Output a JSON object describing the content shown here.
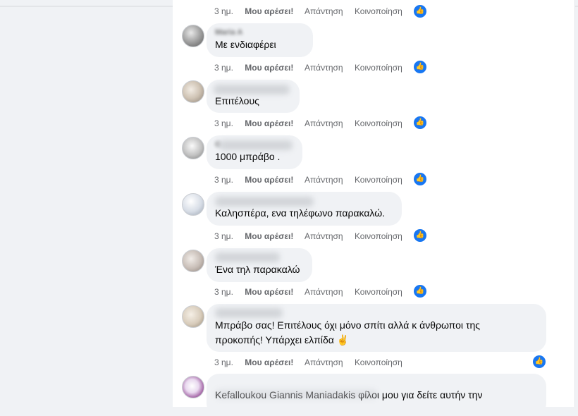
{
  "actions": {
    "time": "3 ημ.",
    "like": "Μου αρέσει!",
    "reply": "Απάντηση",
    "share": "Κοινοποίηση"
  },
  "reaction_icon": "thumbs-up-icon",
  "accent_color": "#1877f2",
  "comments": [
    {
      "name": "Maria A",
      "text": "Με ενδιαφέρει"
    },
    {
      "name": "",
      "text": "Επιτέλους"
    },
    {
      "name": "G",
      "text": "1000 μπράβο ."
    },
    {
      "name": "",
      "text": "Καλησπέρα, ενα τηλέφωνο παρακαλώ."
    },
    {
      "name": "",
      "text": "Ένα τηλ παρακαλώ"
    },
    {
      "name": "",
      "text": "Μπράβο σας! Επιτέλους όχι μόνο σπίτι αλλά κ άνθρωποι της προκοπής! Υπάρχει ελπίδα ✌"
    },
    {
      "name": "",
      "text": "Kefalloukou Giannis Maniadakis φίλοι μου για δείτε αυτήν την"
    }
  ]
}
